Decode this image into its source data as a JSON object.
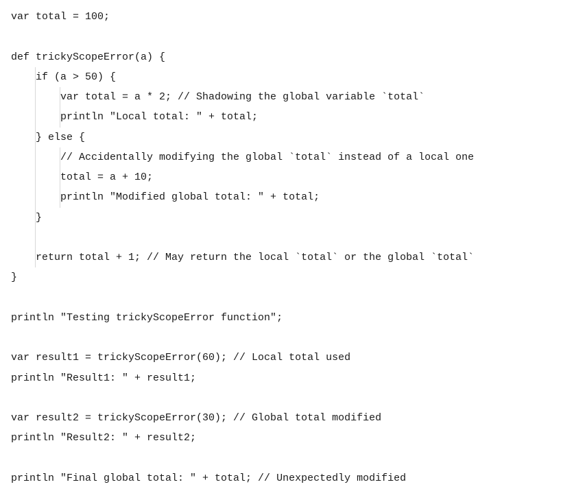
{
  "code": {
    "lines": [
      {
        "text": "var total = 100;",
        "indent": 0
      },
      {
        "text": "",
        "indent": 0
      },
      {
        "text": "def trickyScopeError(a) {",
        "indent": 0
      },
      {
        "text": "    if (a > 50) {",
        "indent": 1
      },
      {
        "text": "        var total = a * 2; // Shadowing the global variable `total`",
        "indent": 2
      },
      {
        "text": "        println \"Local total: \" + total;",
        "indent": 2
      },
      {
        "text": "    } else {",
        "indent": 1
      },
      {
        "text": "        // Accidentally modifying the global `total` instead of a local one",
        "indent": 2
      },
      {
        "text": "        total = a + 10;",
        "indent": 2
      },
      {
        "text": "        println \"Modified global total: \" + total;",
        "indent": 2
      },
      {
        "text": "    }",
        "indent": 1
      },
      {
        "text": "",
        "indent": 1
      },
      {
        "text": "    return total + 1; // May return the local `total` or the global `total`",
        "indent": 1
      },
      {
        "text": "}",
        "indent": 0
      },
      {
        "text": "",
        "indent": 0
      },
      {
        "text": "println \"Testing trickyScopeError function\";",
        "indent": 0
      },
      {
        "text": "",
        "indent": 0
      },
      {
        "text": "var result1 = trickyScopeError(60); // Local total used",
        "indent": 0
      },
      {
        "text": "println \"Result1: \" + result1;",
        "indent": 0
      },
      {
        "text": "",
        "indent": 0
      },
      {
        "text": "var result2 = trickyScopeError(30); // Global total modified",
        "indent": 0
      },
      {
        "text": "println \"Result2: \" + result2;",
        "indent": 0
      },
      {
        "text": "",
        "indent": 0
      },
      {
        "text": "println \"Final global total: \" + total; // Unexpectedly modified",
        "indent": 0
      }
    ]
  }
}
